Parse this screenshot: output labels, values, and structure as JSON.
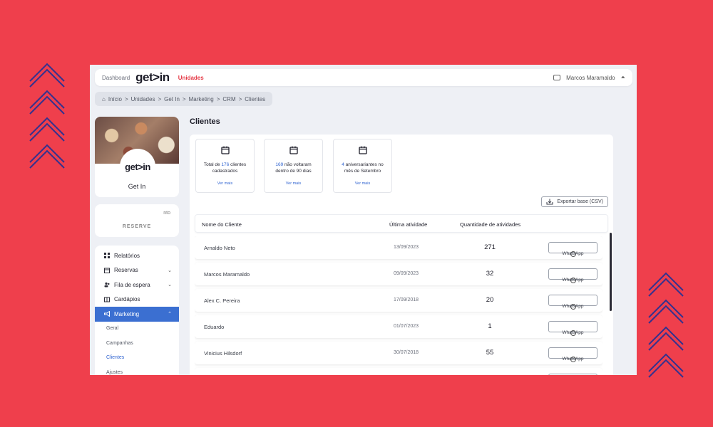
{
  "header": {
    "dashboard_label": "Dashboard",
    "logo_text": "get>in",
    "units_link": "Unidades",
    "user_name": "Marcos Maramaldo"
  },
  "breadcrumb": {
    "items": [
      "Início",
      "Unidades",
      "Get In",
      "Marketing",
      "CRM",
      "Clientes"
    ]
  },
  "profile": {
    "logo_text": "get>in",
    "name": "Get In"
  },
  "reserve_card": {
    "line1": "nto",
    "line2": "RESERVE"
  },
  "sidebar": {
    "items": [
      {
        "label": "Relatórios",
        "icon": "grid-icon"
      },
      {
        "label": "Reservas",
        "icon": "calendar-icon",
        "expandable": true
      },
      {
        "label": "Fila de espera",
        "icon": "people-icon",
        "expandable": true
      },
      {
        "label": "Cardápios",
        "icon": "book-icon"
      },
      {
        "label": "Marketing",
        "icon": "megaphone-icon",
        "expandable": true,
        "active": true
      }
    ],
    "subitems": [
      {
        "label": "Geral"
      },
      {
        "label": "Campanhas"
      },
      {
        "label": "Clientes",
        "active": true
      },
      {
        "label": "Ajustes"
      }
    ]
  },
  "page": {
    "title": "Clientes"
  },
  "stats": [
    {
      "pre": "Total de ",
      "num": "176",
      "post": " clientes cadastrados",
      "more": "Ver mais"
    },
    {
      "pre": "",
      "num": "169",
      "post": " não voltaram dentro de 90 dias",
      "more": "Ver mais"
    },
    {
      "pre": "",
      "num": "4",
      "post": " aniversariantes no mês de Setembro",
      "more": "Ver mais"
    }
  ],
  "export_label": "Exportar base (CSV)",
  "table": {
    "headers": {
      "name": "Nome do Cliente",
      "last": "Última atividade",
      "qty": "Quantidade de atividades"
    },
    "whatsapp_label": "WhatsApp",
    "rows": [
      {
        "name": "Arnaldo Neto",
        "date": "13/09/2023",
        "count": "271"
      },
      {
        "name": "Marcos Maramaldo",
        "date": "09/09/2023",
        "count": "32"
      },
      {
        "name": "Alex C. Pereira",
        "date": "17/09/2018",
        "count": "20"
      },
      {
        "name": "Eduardo",
        "date": "01/07/2023",
        "count": "1"
      },
      {
        "name": "Vinicius Hilsdorf",
        "date": "30/07/2018",
        "count": "55"
      },
      {
        "name": "",
        "date": "",
        "count": ""
      }
    ]
  },
  "colors": {
    "background": "#ef3f4c",
    "accent_blue": "#3b6fd1",
    "brand_red": "#e53a47",
    "chevron_stroke": "#3a3aa0"
  }
}
